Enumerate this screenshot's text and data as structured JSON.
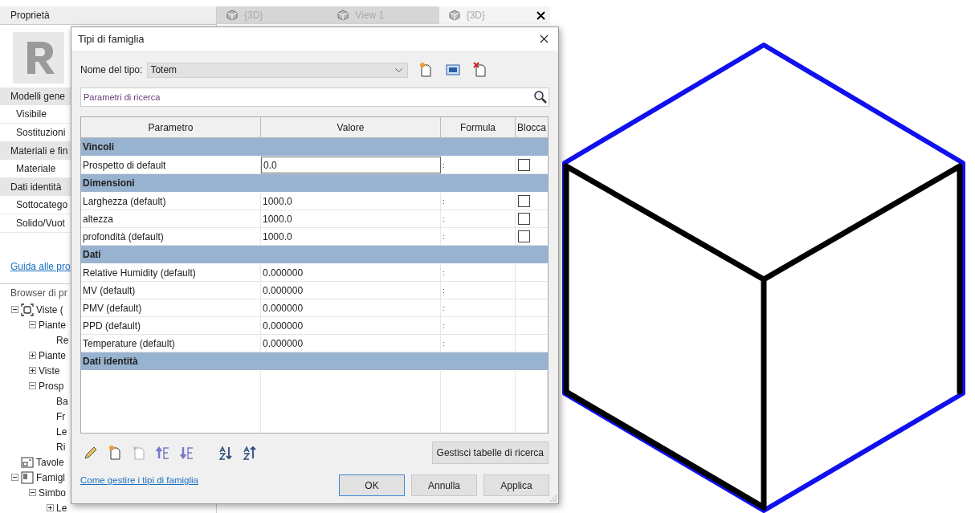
{
  "properties": {
    "title": "Proprietà",
    "rows": [
      {
        "kind": "category",
        "label": "Modelli gene"
      },
      {
        "kind": "param",
        "label": "Visibile"
      },
      {
        "kind": "param",
        "label": "Sostituzioni"
      },
      {
        "kind": "category",
        "label": "Materiali e fin"
      },
      {
        "kind": "param",
        "label": "Materiale"
      },
      {
        "kind": "category",
        "label": "Dati identità"
      },
      {
        "kind": "param",
        "label": "Sottocatego"
      },
      {
        "kind": "param",
        "label": "Solido/Vuot"
      }
    ],
    "help_link": "Guida alle pro"
  },
  "browser": {
    "title": "Browser di pr",
    "tree": [
      {
        "label": "Viste (",
        "kind": "views",
        "expanded": true,
        "children": [
          {
            "label": "Piante",
            "expanded": true,
            "children": [
              {
                "label": "Re"
              }
            ]
          },
          {
            "label": "Piante",
            "expanded": false
          },
          {
            "label": "Viste",
            "expanded": false
          },
          {
            "label": "Prosp",
            "expanded": true,
            "children": [
              {
                "label": "Ba"
              },
              {
                "label": "Fr"
              },
              {
                "label": "Le"
              },
              {
                "label": "Ri"
              }
            ]
          }
        ]
      },
      {
        "label": "Tavole",
        "kind": "sheets"
      },
      {
        "label": "Famigl",
        "kind": "families",
        "expanded": true,
        "children": [
          {
            "label": "Simbo",
            "expanded": true,
            "children": [
              {
                "label": "Le",
                "expanded": false
              }
            ]
          }
        ]
      }
    ]
  },
  "tabs": [
    {
      "label": "{3D}",
      "selected": false
    },
    {
      "label": "View 1",
      "selected": false
    },
    {
      "label": "{3D}",
      "selected": true
    }
  ],
  "dialog": {
    "title": "Tipi di famiglia",
    "type_label": "Nome del tipo:",
    "type_value": "Totem",
    "search": {
      "placeholder": "Parametri di ricerca"
    },
    "table": {
      "columns": [
        "Parametro",
        "Valore",
        "Formula",
        "Blocca"
      ],
      "groups": [
        {
          "name": "Vincoli",
          "rows": [
            {
              "parameter": "Prospetto di default",
              "value": "0.0",
              "formula": ":",
              "kind": "lockable",
              "locked": false,
              "editing": true
            }
          ]
        },
        {
          "name": "Dimensioni",
          "rows": [
            {
              "parameter": "Larghezza (default)",
              "value": "1000.0",
              "formula": ":",
              "kind": "lockable",
              "locked": false,
              "editing": false
            },
            {
              "parameter": "altezza",
              "value": "1000.0",
              "formula": ":",
              "kind": "lockable",
              "locked": false,
              "editing": false
            },
            {
              "parameter": "profondità (default)",
              "value": "1000.0",
              "formula": ":",
              "kind": "lockable",
              "locked": false,
              "editing": false
            }
          ]
        },
        {
          "name": "Dati",
          "rows": [
            {
              "parameter": "Relative Humidity (default)",
              "value": "0.000000",
              "formula": ":",
              "kind": "plain",
              "editing": false
            },
            {
              "parameter": "MV (default)",
              "value": "0.000000",
              "formula": ":",
              "kind": "plain",
              "editing": false
            },
            {
              "parameter": "PMV (default)",
              "value": "0.000000",
              "formula": ":",
              "kind": "plain",
              "editing": false
            },
            {
              "parameter": "PPD (default)",
              "value": "0.000000",
              "formula": ":",
              "kind": "plain",
              "editing": false
            },
            {
              "parameter": "Temperature (default)",
              "value": "0.000000",
              "formula": ":",
              "kind": "plain",
              "editing": false
            }
          ]
        },
        {
          "name": "Dati identità"
        }
      ]
    },
    "lookup_button": "Gestisci tabelle di ricerca",
    "help_link": "Come gestire i tipi di famiglia",
    "buttons": [
      {
        "label": "OK",
        "default": true
      },
      {
        "label": "Annulla",
        "default": false
      },
      {
        "label": "Applica",
        "default": false
      }
    ]
  }
}
